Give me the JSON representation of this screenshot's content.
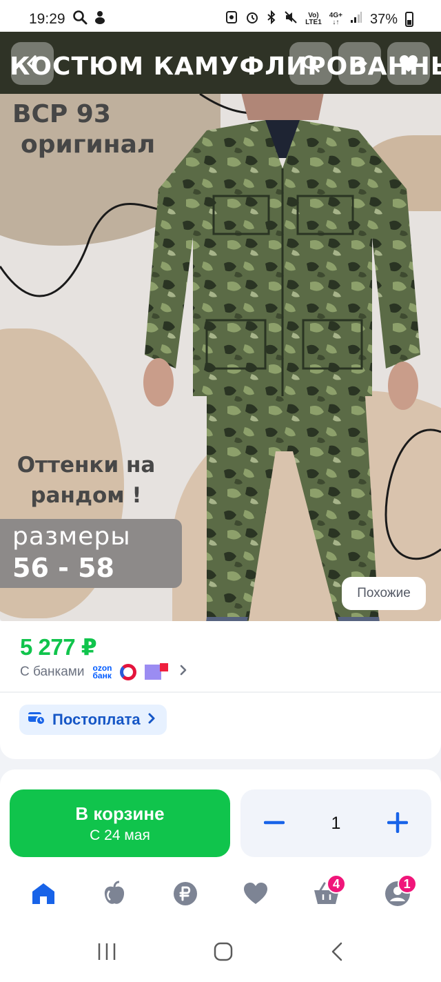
{
  "status_bar": {
    "time": "19:29",
    "network_top": "Vo)",
    "network_bottom": "LTE1",
    "net4g_top": "4G+",
    "net4g_bottom": "↓↑",
    "battery": "37%"
  },
  "product_image": {
    "banner_title": "КОСТЮМ КАМУФЛИРОВАННЫЙ",
    "promo_line1": "ВСР 93",
    "promo_line2": "оригинал",
    "promo_shades_line1": "Оттенки на",
    "promo_shades_line2": "рандом !",
    "sizes_label": "размеры",
    "sizes_value": "56 - 58",
    "similar_button": "Похожие"
  },
  "price_card": {
    "price": "5 277 ₽",
    "banks_label": "С банками",
    "ozon_bank_line1": "ozon",
    "ozon_bank_line2": "банк",
    "postpay_label": "Постоплата"
  },
  "actions": {
    "cart_button_title": "В корзине",
    "cart_button_subtitle": "С 24 мая",
    "quantity": "1",
    "minus": "−",
    "plus": "+"
  },
  "bottom_nav": {
    "items": [
      {
        "name": "home",
        "icon": "home-icon"
      },
      {
        "name": "fresh",
        "icon": "apple-icon"
      },
      {
        "name": "finance",
        "icon": "ruble-icon"
      },
      {
        "name": "favorites",
        "icon": "heart-icon"
      },
      {
        "name": "cart",
        "icon": "basket-icon",
        "badge": "4"
      },
      {
        "name": "profile",
        "icon": "profile-icon",
        "badge": "1"
      }
    ]
  },
  "colors": {
    "accent_green": "#10c44c",
    "accent_blue": "#1863e8",
    "badge_pink": "#f0167a"
  }
}
